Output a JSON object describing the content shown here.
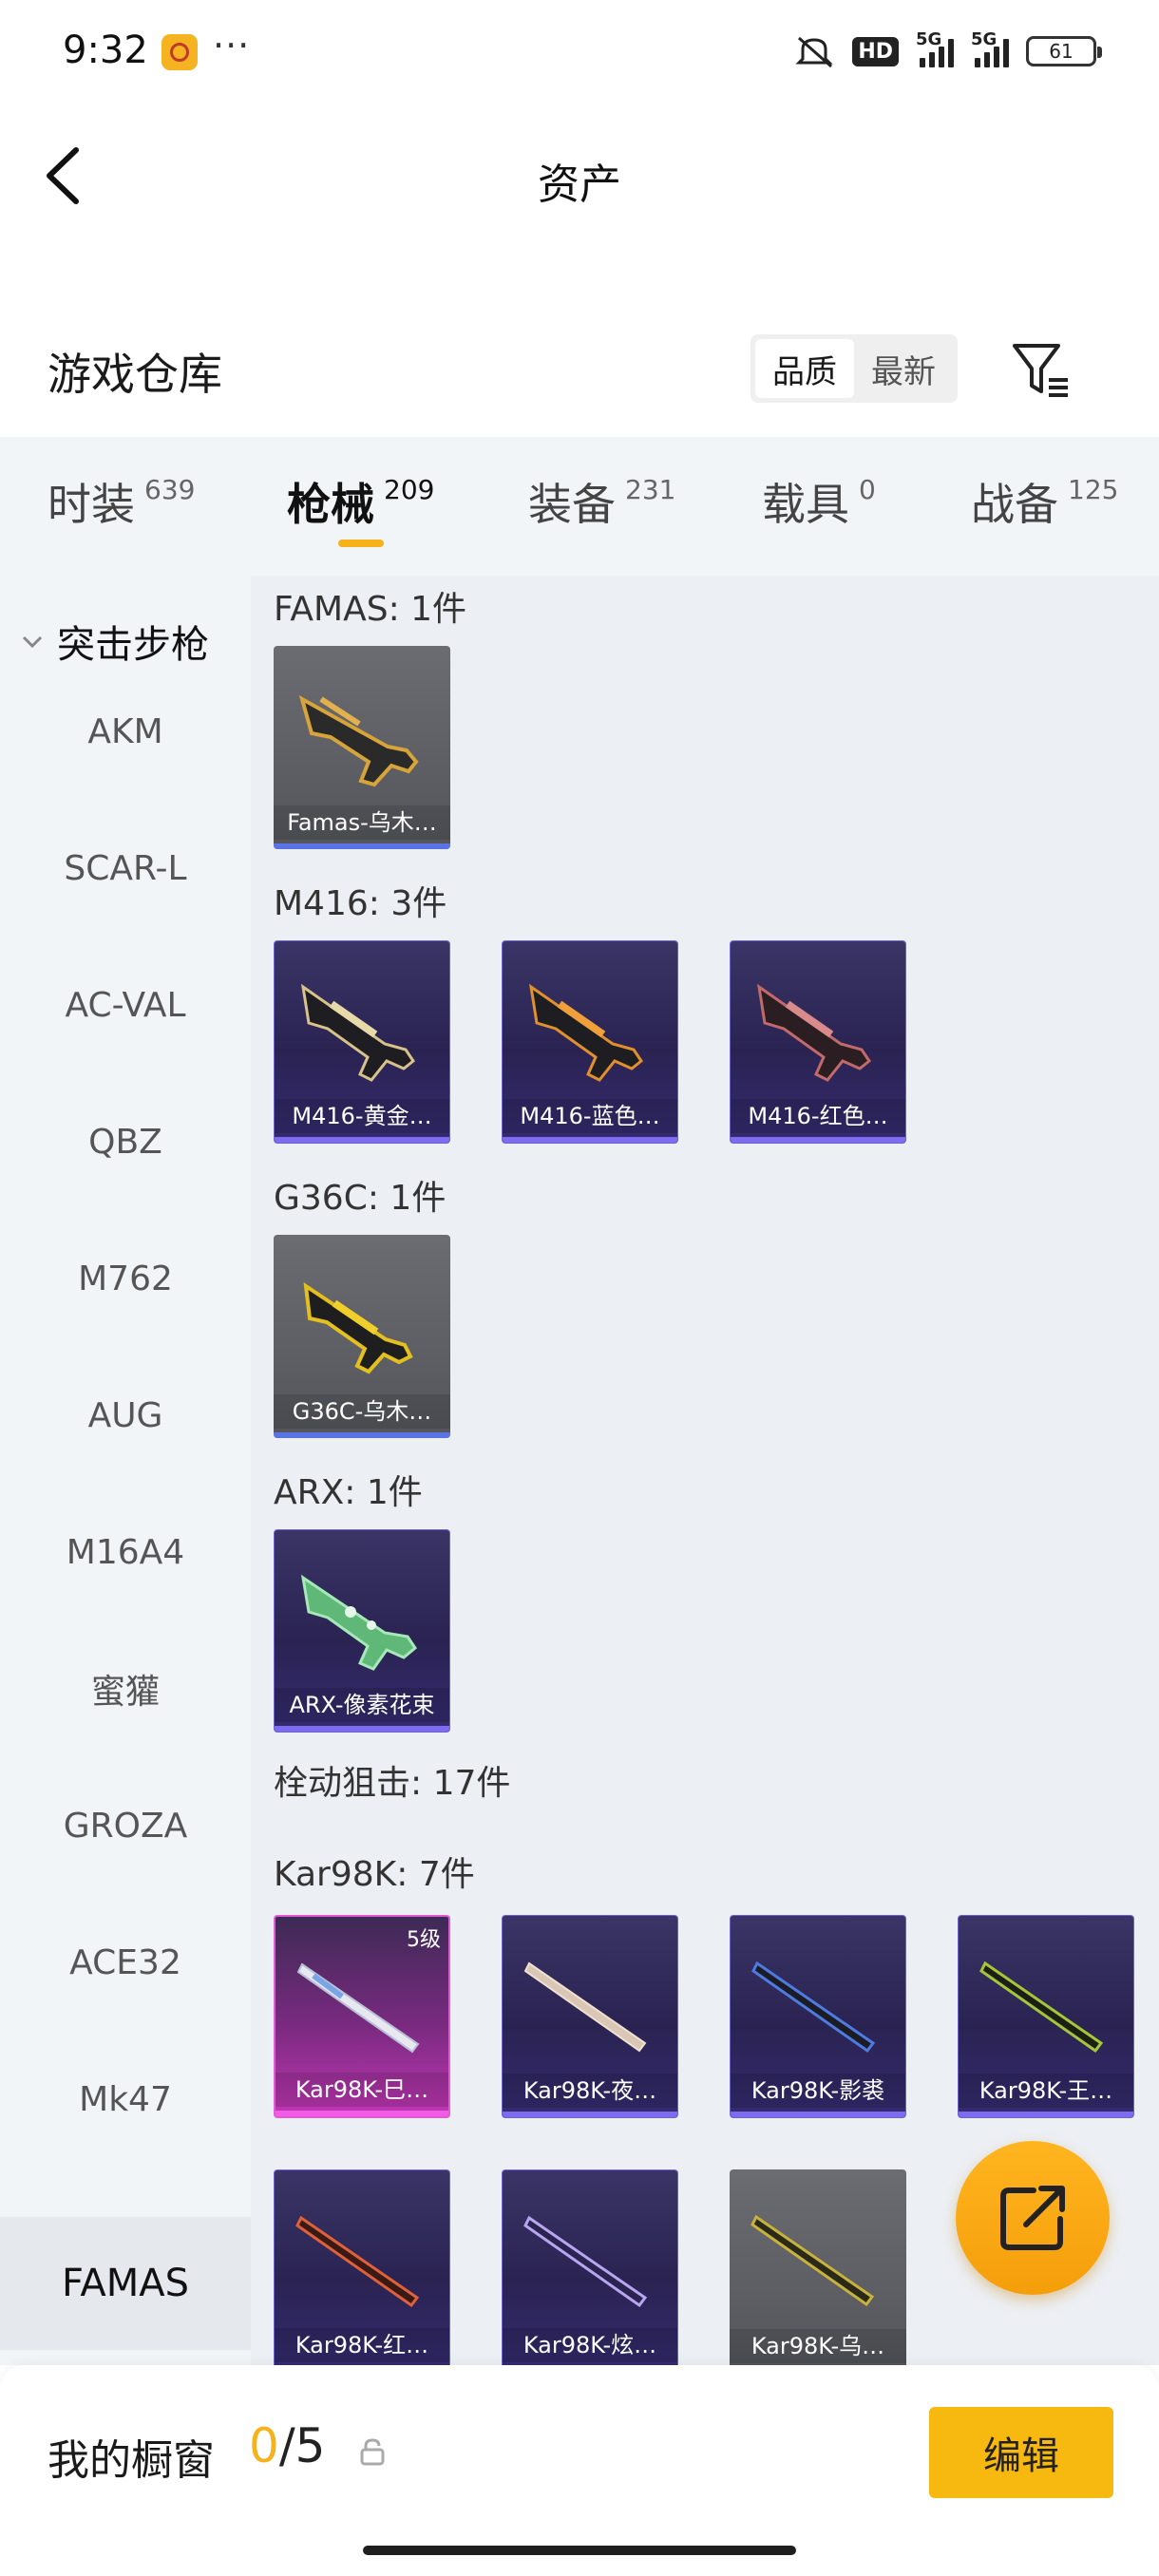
{
  "status_bar": {
    "time": "9:32",
    "more": "···",
    "hd": "HD",
    "net1": "5G",
    "net2": "5G",
    "battery": "61"
  },
  "header": {
    "title": "资产"
  },
  "warehouse": {
    "title": "游戏仓库",
    "sort_options": [
      "品质",
      "最新"
    ],
    "active_sort": "品质"
  },
  "tabs": [
    {
      "label": "时装",
      "count": "639"
    },
    {
      "label": "枪械",
      "count": "209"
    },
    {
      "label": "装备",
      "count": "231"
    },
    {
      "label": "载具",
      "count": "0"
    },
    {
      "label": "战备",
      "count": "125"
    }
  ],
  "active_tab": "枪械",
  "sidebar": {
    "group": "突击步枪",
    "items": [
      "AKM",
      "SCAR-L",
      "AC-VAL",
      "QBZ",
      "M762",
      "AUG",
      "M16A4",
      "蜜獾",
      "GROZA",
      "ACE32",
      "Mk47",
      "FAMAS"
    ],
    "active": "FAMAS"
  },
  "sections": [
    {
      "title": "FAMAS: 1件",
      "items": [
        {
          "name": "Famas-乌木…",
          "rarity": "grey"
        }
      ]
    },
    {
      "title": "M416: 3件",
      "items": [
        {
          "name": "M416-黄金…",
          "rarity": "purple"
        },
        {
          "name": "M416-蓝色…",
          "rarity": "purple"
        },
        {
          "name": "M416-红色…",
          "rarity": "purple"
        }
      ]
    },
    {
      "title": "G36C: 1件",
      "items": [
        {
          "name": "G36C-乌木…",
          "rarity": "grey"
        }
      ]
    },
    {
      "title": "ARX: 1件",
      "items": [
        {
          "name": "ARX-像素花束",
          "rarity": "purple"
        }
      ]
    },
    {
      "title": "栓动狙击: 17件",
      "items": []
    },
    {
      "title": "Kar98K: 7件",
      "items": [
        {
          "name": "Kar98K-巳…",
          "rarity": "pink",
          "level": "5级"
        },
        {
          "name": "Kar98K-夜…",
          "rarity": "purple"
        },
        {
          "name": "Kar98K-影裘",
          "rarity": "purple"
        },
        {
          "name": "Kar98K-王…",
          "rarity": "purple"
        },
        {
          "name": "Kar98K-红…",
          "rarity": "purple"
        },
        {
          "name": "Kar98K-炫…",
          "rarity": "purple"
        },
        {
          "name": "Kar98K-乌…",
          "rarity": "grey"
        }
      ]
    }
  ],
  "showcase": {
    "title": "我的橱窗",
    "current": "0",
    "separator": "/",
    "max": "5",
    "edit_label": "编辑"
  },
  "colors": {
    "accent": "#f7b80f",
    "purple_frame": "#7d6cf2",
    "pink_frame": "#f05ce6",
    "grey_frame": "#5a74e6"
  },
  "icons": [
    "back-arrow-icon",
    "filter-icon",
    "chevron-down-icon",
    "share-export-icon",
    "lock-icon",
    "mute-icon"
  ]
}
